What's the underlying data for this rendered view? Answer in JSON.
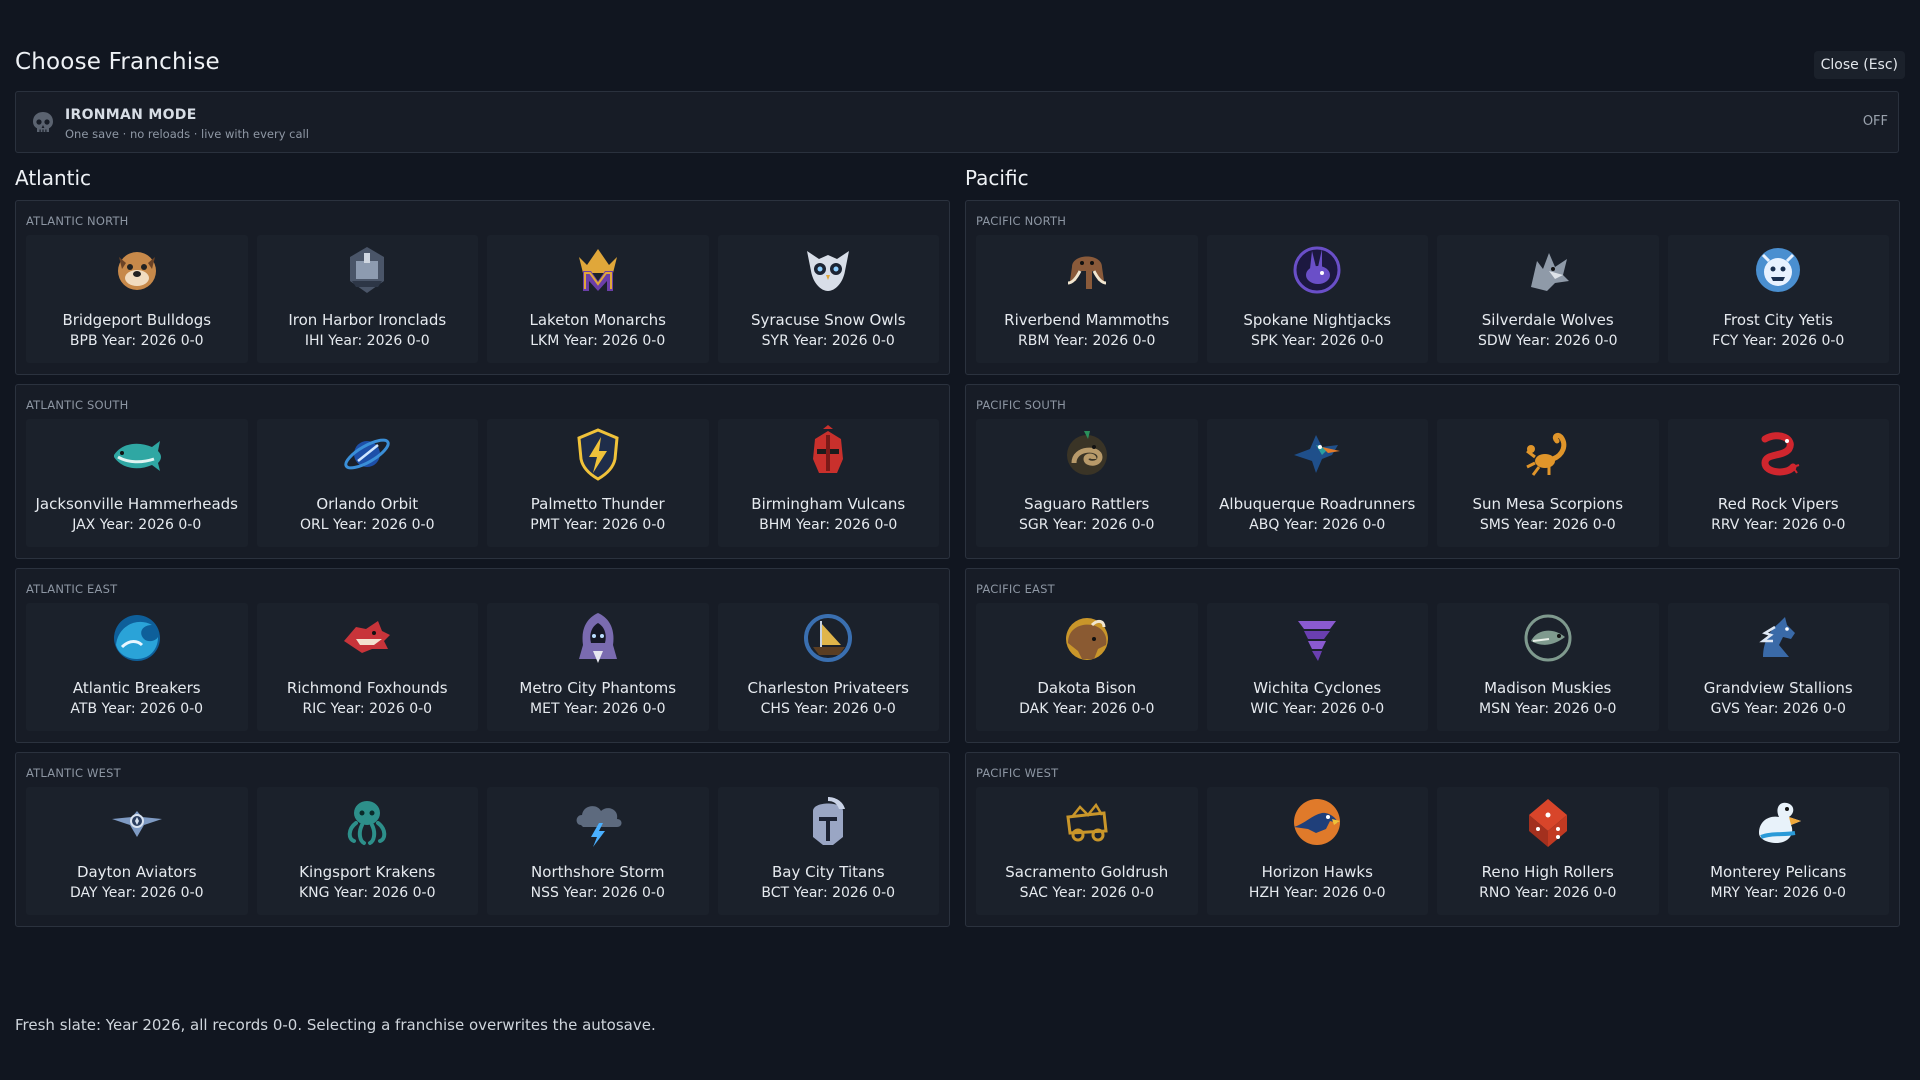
{
  "header": {
    "title": "Choose Franchise",
    "close_label": "Close (Esc)"
  },
  "ironman": {
    "icon": "skull-icon",
    "title": "IRONMAN MODE",
    "subtitle": "One save · no reloads · live with every call",
    "state": "OFF"
  },
  "conferences": [
    {
      "name": "Atlantic",
      "divisions": [
        {
          "name": "ATLANTIC NORTH",
          "teams": [
            {
              "name": "Bridgeport Bulldogs",
              "abbr": "BPB",
              "year": "Year: 2026",
              "record": "0-0",
              "logo": "bulldog-logo-icon",
              "color": "#c7894a"
            },
            {
              "name": "Iron Harbor Ironclads",
              "abbr": "IHI",
              "year": "Year: 2026",
              "record": "0-0",
              "logo": "ironclad-ship-logo-icon",
              "color": "#8d9bb0"
            },
            {
              "name": "Laketon Monarchs",
              "abbr": "LKM",
              "year": "Year: 2026",
              "record": "0-0",
              "logo": "crown-m-logo-icon",
              "color": "#e0a73a"
            },
            {
              "name": "Syracuse Snow Owls",
              "abbr": "SYR",
              "year": "Year: 2026",
              "record": "0-0",
              "logo": "owl-logo-icon",
              "color": "#d8dee8"
            }
          ]
        },
        {
          "name": "ATLANTIC SOUTH",
          "teams": [
            {
              "name": "Jacksonville Hammerheads",
              "abbr": "JAX",
              "year": "Year: 2026",
              "record": "0-0",
              "logo": "hammerhead-shark-logo-icon",
              "color": "#2fa7a3"
            },
            {
              "name": "Orlando Orbit",
              "abbr": "ORL",
              "year": "Year: 2026",
              "record": "0-0",
              "logo": "planet-orbit-logo-icon",
              "color": "#3a8fd8"
            },
            {
              "name": "Palmetto Thunder",
              "abbr": "PMT",
              "year": "Year: 2026",
              "record": "0-0",
              "logo": "lightning-shield-logo-icon",
              "color": "#f0c23a"
            },
            {
              "name": "Birmingham Vulcans",
              "abbr": "BHM",
              "year": "Year: 2026",
              "record": "0-0",
              "logo": "vulcan-helmet-logo-icon",
              "color": "#c9302c"
            }
          ]
        },
        {
          "name": "ATLANTIC EAST",
          "teams": [
            {
              "name": "Atlantic Breakers",
              "abbr": "ATB",
              "year": "Year: 2026",
              "record": "0-0",
              "logo": "wave-logo-icon",
              "color": "#2aa3d8"
            },
            {
              "name": "Richmond Foxhounds",
              "abbr": "RIC",
              "year": "Year: 2026",
              "record": "0-0",
              "logo": "foxhound-logo-icon",
              "color": "#c8343a"
            },
            {
              "name": "Metro City Phantoms",
              "abbr": "MET",
              "year": "Year: 2026",
              "record": "0-0",
              "logo": "hooded-phantom-logo-icon",
              "color": "#7a6bb0"
            },
            {
              "name": "Charleston Privateers",
              "abbr": "CHS",
              "year": "Year: 2026",
              "record": "0-0",
              "logo": "privateer-ship-logo-icon",
              "color": "#e0b54a"
            }
          ]
        },
        {
          "name": "ATLANTIC WEST",
          "teams": [
            {
              "name": "Dayton Aviators",
              "abbr": "DAY",
              "year": "Year: 2026",
              "record": "0-0",
              "logo": "winged-aviator-logo-icon",
              "color": "#7f9bc4"
            },
            {
              "name": "Kingsport Krakens",
              "abbr": "KNG",
              "year": "Year: 2026",
              "record": "0-0",
              "logo": "kraken-logo-icon",
              "color": "#2d8f8a"
            },
            {
              "name": "Northshore Storm",
              "abbr": "NSS",
              "year": "Year: 2026",
              "record": "0-0",
              "logo": "storm-cloud-logo-icon",
              "color": "#5d6a7e"
            },
            {
              "name": "Bay City Titans",
              "abbr": "BCT",
              "year": "Year: 2026",
              "record": "0-0",
              "logo": "titan-helmet-logo-icon",
              "color": "#9aa6c4"
            }
          ]
        }
      ]
    },
    {
      "name": "Pacific",
      "divisions": [
        {
          "name": "PACIFIC NORTH",
          "teams": [
            {
              "name": "Riverbend Mammoths",
              "abbr": "RBM",
              "year": "Year: 2026",
              "record": "0-0",
              "logo": "mammoth-logo-icon",
              "color": "#8a5a3a"
            },
            {
              "name": "Spokane Nightjacks",
              "abbr": "SPK",
              "year": "Year: 2026",
              "record": "0-0",
              "logo": "jackrabbit-logo-icon",
              "color": "#6a4fc8"
            },
            {
              "name": "Silverdale Wolves",
              "abbr": "SDW",
              "year": "Year: 2026",
              "record": "0-0",
              "logo": "wolf-logo-icon",
              "color": "#8f9aa8"
            },
            {
              "name": "Frost City Yetis",
              "abbr": "FCY",
              "year": "Year: 2026",
              "record": "0-0",
              "logo": "yeti-logo-icon",
              "color": "#4a8fd0"
            }
          ]
        },
        {
          "name": "PACIFIC SOUTH",
          "teams": [
            {
              "name": "Saguaro Rattlers",
              "abbr": "SGR",
              "year": "Year: 2026",
              "record": "0-0",
              "logo": "rattlesnake-logo-icon",
              "color": "#b89a6a"
            },
            {
              "name": "Albuquerque Roadrunners",
              "abbr": "ABQ",
              "year": "Year: 2026",
              "record": "0-0",
              "logo": "roadrunner-logo-icon",
              "color": "#2aa0a0"
            },
            {
              "name": "Sun Mesa Scorpions",
              "abbr": "SMS",
              "year": "Year: 2026",
              "record": "0-0",
              "logo": "scorpion-logo-icon",
              "color": "#e0952a"
            },
            {
              "name": "Red Rock Vipers",
              "abbr": "RRV",
              "year": "Year: 2026",
              "record": "0-0",
              "logo": "viper-logo-icon",
              "color": "#d0262e"
            }
          ]
        },
        {
          "name": "PACIFIC EAST",
          "teams": [
            {
              "name": "Dakota Bison",
              "abbr": "DAK",
              "year": "Year: 2026",
              "record": "0-0",
              "logo": "bison-logo-icon",
              "color": "#8a5a32"
            },
            {
              "name": "Wichita Cyclones",
              "abbr": "WIC",
              "year": "Year: 2026",
              "record": "0-0",
              "logo": "cyclone-logo-icon",
              "color": "#8a5ad0"
            },
            {
              "name": "Madison Muskies",
              "abbr": "MSN",
              "year": "Year: 2026",
              "record": "0-0",
              "logo": "muskie-fish-logo-icon",
              "color": "#7f9a8e"
            },
            {
              "name": "Grandview Stallions",
              "abbr": "GVS",
              "year": "Year: 2026",
              "record": "0-0",
              "logo": "stallion-logo-icon",
              "color": "#3a6aa8"
            }
          ]
        },
        {
          "name": "PACIFIC WEST",
          "teams": [
            {
              "name": "Sacramento Goldrush",
              "abbr": "SAC",
              "year": "Year: 2026",
              "record": "0-0",
              "logo": "gold-wagon-logo-icon",
              "color": "#c9962a"
            },
            {
              "name": "Horizon Hawks",
              "abbr": "HZH",
              "year": "Year: 2026",
              "record": "0-0",
              "logo": "hawk-sunset-logo-icon",
              "color": "#e07a2a"
            },
            {
              "name": "Reno High Rollers",
              "abbr": "RNO",
              "year": "Year: 2026",
              "record": "0-0",
              "logo": "dice-logo-icon",
              "color": "#d8452a"
            },
            {
              "name": "Monterey Pelicans",
              "abbr": "MRY",
              "year": "Year: 2026",
              "record": "0-0",
              "logo": "pelican-logo-icon",
              "color": "#2a9ad8"
            }
          ]
        }
      ]
    }
  ],
  "footer": {
    "note": "Fresh slate: Year 2026, all records 0-0. Selecting a franchise overwrites the autosave."
  }
}
